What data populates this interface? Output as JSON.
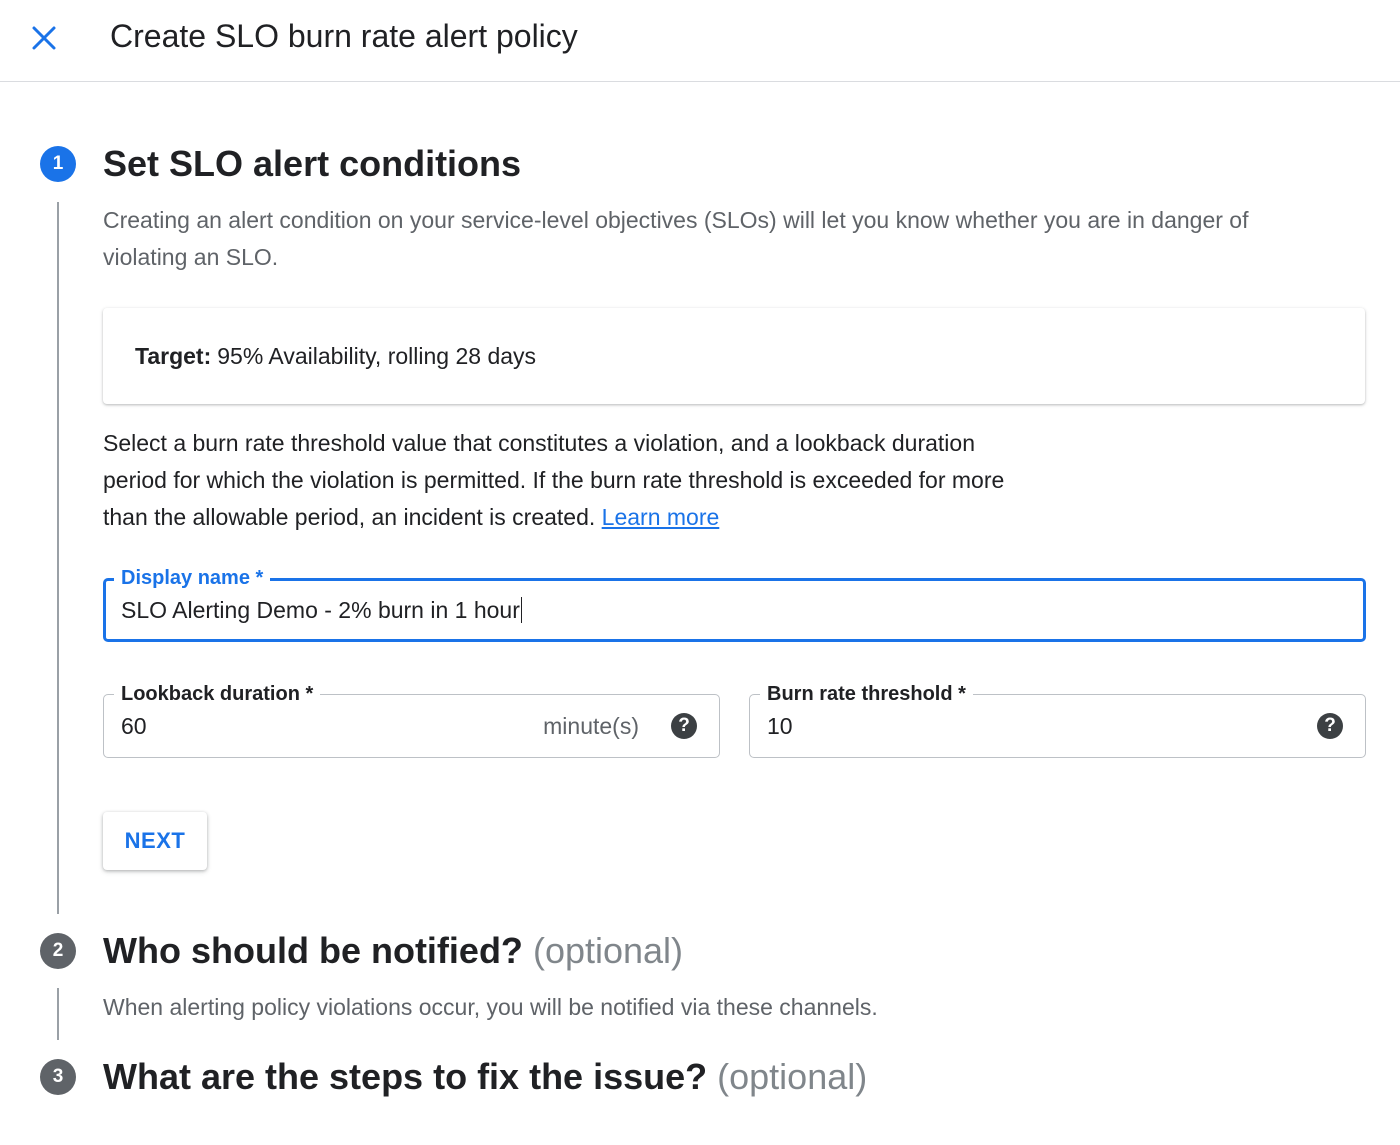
{
  "header": {
    "title": "Create SLO burn rate alert policy",
    "close_icon": "close-icon",
    "accent_color": "#1a73e8"
  },
  "steps": [
    {
      "number": "1",
      "state": "active",
      "title": "Set SLO alert conditions",
      "description": "Creating an alert condition on your service-level objectives (SLOs) will let you know whether you are in danger of violating an SLO."
    },
    {
      "number": "2",
      "state": "inactive",
      "title": "Who should be notified?",
      "optional": "(optional)",
      "description": "When alerting policy violations occur, you will be notified via these channels."
    },
    {
      "number": "3",
      "state": "inactive",
      "title": "What are the steps to fix the issue?",
      "optional": "(optional)"
    }
  ],
  "target_card": {
    "label": "Target:",
    "value": "95% Availability, rolling 28 days"
  },
  "instructions": {
    "text": "Select a burn rate threshold value that constitutes a violation, and a lookback duration period for which the violation is permitted. If the burn rate threshold is exceeded for more than the allowable period, an incident is created.",
    "link": "Learn more"
  },
  "fields": {
    "display_name": {
      "label": "Display name *",
      "value": "SLO Alerting Demo - 2% burn in 1 hour"
    },
    "lookback_duration": {
      "label": "Lookback duration *",
      "value": "60",
      "suffix": "minute(s)",
      "help_icon": "help-icon"
    },
    "burn_rate_threshold": {
      "label": "Burn rate threshold *",
      "value": "10",
      "help_icon": "help-icon"
    }
  },
  "buttons": {
    "next": "NEXT"
  }
}
